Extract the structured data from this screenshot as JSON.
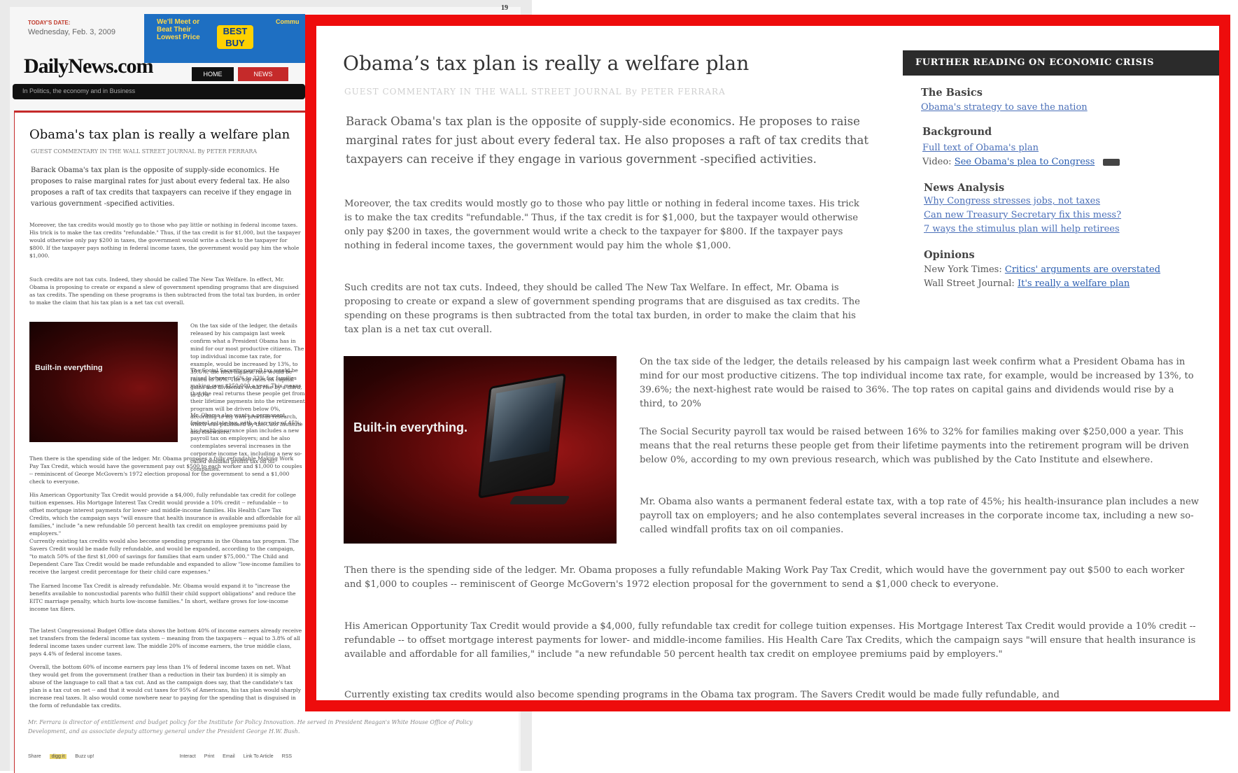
{
  "background_page": {
    "page_number": "19",
    "date_label": "TODAY'S DATE:",
    "date": "Wednesday, Feb. 3, 2009",
    "ad": {
      "tagline": "We'll Meet or Beat Their Lowest Price",
      "logo": "BEST BUY",
      "side_text": "Commu"
    },
    "logo": "DailyNews.com",
    "tabs": [
      "HOME",
      "NEWS"
    ],
    "nav_text": "In Politics, the economy and in Business",
    "title": "Obama's tax plan is really a welfare plan",
    "subtitle": "GUEST COMMENTARY IN THE WALL STREET JOURNAL By PETER FERRARA",
    "image_caption": "Built-in everything",
    "footer_note": "Mr. Ferrara is director of entitlement and budget policy for the Institute for Policy Innovation. He served in President Reagan's White House Office of Policy Development, and as associate deputy attorney general under the President George H.W. Bush.",
    "share": {
      "share_label": "Share",
      "digg": "digg it",
      "buzz": "Buzz up!",
      "interact": "Interact",
      "print": "Print",
      "email": "Email",
      "link": "Link To Article",
      "rss": "RSS"
    },
    "lower_paras": [
      "Then there is the spending side of the ledger. Mr. Obama proposes a fully refundable Making Work Pay Tax Credit, which would have the government pay out $500 to each worker and $1,000 to couples -- reminiscent of George McGovern's 1972 election proposal for the government to send a $1,000 check to everyone.",
      "His American Opportunity Tax Credit would provide a $4,000, fully refundable tax credit for college tuition expenses. His Mortgage Interest Tax Credit would provide a 10% credit -- refundable -- to offset mortgage interest payments for lower- and middle-income families. His Health Care Tax Credits, which the campaign says \"will ensure that health insurance is available and affordable for all families,\" include \"a new refundable 50 percent health tax credit on employee premiums paid by employers.\"",
      "Currently existing tax credits would also become spending programs in the Obama tax program. The Savers Credit would be made fully refundable, and would be expanded, according to the campaign, \"to match 50% of the first $1,000 of savings for families that earn under $75,000.\" The Child and Dependent Care Tax Credit would be made refundable and expanded to allow \"low-income families to receive the largest credit percentage for their child care expenses.\"",
      "The Earned Income Tax Credit is already refundable. Mr. Obama would expand it to \"increase the benefits available to noncustodial parents who fulfill their child support obligations\" and reduce the EITC marriage penalty, which hurts low-income families.\" In short, welfare grows for low-income income tax filers.",
      "The latest Congressional Budget Office data shows the bottom 40% of income earners already receive net transfers from the federal income tax system -- meaning from the taxpayers -- equal to 3.8% of all federal income taxes under current law. The middle 20% of income earners, the true middle class, pays 4.4% of federal income taxes.",
      "Overall, the bottom 60% of income earners pay less than 1% of federal income taxes on net. What they would get from the government (rather than a reduction in their tax burden) it is simply an abuse of the language to call that a tax cut. And as the campaign does say, that the candidate's tax plan is a tax cut on net -- and that it would cut taxes for 95% of Americans, his tax plan would sharply increase real taxes. It also would come nowhere near to paying for the spending that is disguised in the form of refundable tax credits."
    ]
  },
  "article": {
    "title": "Obama’s tax plan is really a welfare plan",
    "subtitle": "GUEST COMMENTARY IN THE WALL STREET JOURNAL By PETER FERRARA",
    "lead": "Barack Obama's tax plan is the opposite of supply-side economics. He proposes to raise marginal rates for just about every federal tax. He also proposes a raft of tax credits that taxpayers can receive if they engage in various government -specified activities.",
    "para1": "Moreover, the tax credits would mostly go to those who pay little or nothing in federal income taxes. His trick is to make the tax credits \"refundable.\" Thus, if the tax credit is for $1,000, but the taxpayer would otherwise only pay $200 in taxes, the government would write a check to the taxpayer for $800. If the taxpayer pays nothing in federal income taxes, the government would pay him the whole $1,000.",
    "para2": "Such credits are not tax cuts. Indeed, they should be called The New Tax Welfare. In effect, Mr. Obama is proposing to create or expand a slew of government spending programs that are disguised as tax credits. The spending on these programs is then subtracted from the total tax burden, in order to make the claim that his tax plan is a net tax cut overall.",
    "image_caption": "Built-in everything.",
    "side1": "On the tax side of the ledger, the details released by his campaign last week confirm what a President Obama has in mind for our most productive citizens. The top individual income tax rate, for example, would be increased by 13%, to 39.6%; the next-highest rate would be raised to 36%. The top rates on capital gains and dividends would rise by a third, to 20%",
    "side2": "The Social Security payroll tax would be raised between 16% to 32% for families making over $250,000 a year. This means that the real returns these people get from their lifetime payments into the retirement program will be driven below 0%, according to my own previous research, which was published by the Cato Institute and elsewhere.",
    "side3": "Mr. Obama also wants a permanent federal estate tax, with a top rate of 45%; his health-insurance plan includes a new payroll tax on employers; and he also contemplates several increases in the corporate income tax, including a new so-called windfall profits tax on oil companies.",
    "para3": "Then there is the spending side of the ledger. Mr. Obama proposes a fully refundable Making Work Pay Tax Credit, which would have the government pay out $500 to each worker and $1,000 to couples -- reminiscent of George McGovern's 1972 election proposal for the government to send a $1,000 check to everyone.",
    "para4": "His American Opportunity Tax Credit would provide a $4,000, fully refundable tax credit for college tuition expenses. His Mortgage Interest Tax Credit would provide a 10% credit -- refundable -- to offset mortgage interest payments for lower- and middle-income families. His Health Care Tax Credits, which the campaign says \"will ensure that health insurance is available and affordable for all families,\" include \"a new refundable 50 percent health tax credit on employee premiums paid by employers.\"",
    "para5": "Currently existing tax credits would also become spending programs in the Obama tax program. The Savers Credit would be made fully refundable, and"
  },
  "sidebar": {
    "header": "FURTHER READING ON ECONOMIC CRISIS",
    "basics_heading": "The Basics",
    "basics_link": "Obama's strategy to save the nation",
    "background_heading": "Background",
    "background_link": "Full text of Obama's plan",
    "video_label": "Video:",
    "video_link": "See Obama's plea to Congress",
    "news_heading": "News Analysis",
    "news_links": [
      "Why Congress stresses jobs, not taxes",
      "Can new Treasury Secretary fix this mess?",
      "7 ways the stimulus plan will help retirees"
    ],
    "opinions_heading": "Opinions",
    "nyt_label": "New York Times:",
    "nyt_link": "Critics' arguments are overstated",
    "wsj_label": "Wall Street Journal:",
    "wsj_link": "It's really a welfare plan"
  },
  "colors": {
    "callout_border": "#ee0c0c",
    "sidebar_header": "#2b2b2b",
    "link": "#4a6fb8"
  }
}
